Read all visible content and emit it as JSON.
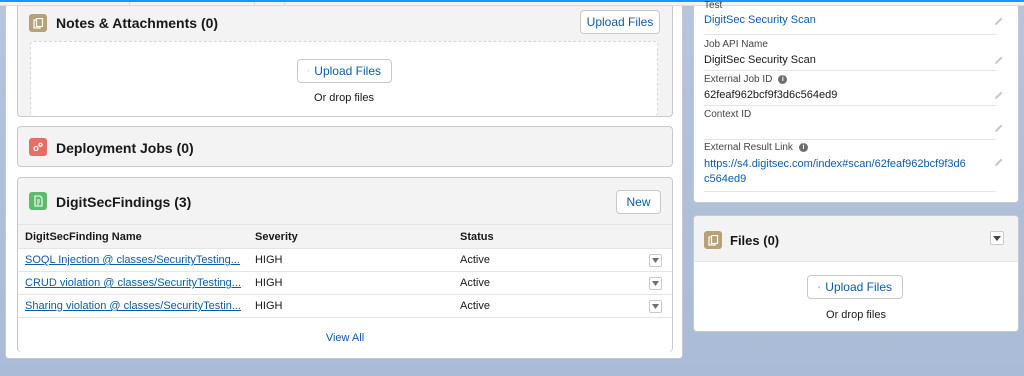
{
  "notes": {
    "title": "Notes & Attachments (0)",
    "upload_button": "Upload Files",
    "drop_upload_button": "Upload Files",
    "drop_text": "Or drop files"
  },
  "deployment": {
    "title": "Deployment Jobs (0)"
  },
  "findings": {
    "title": "DigitSecFindings (3)",
    "new_button": "New",
    "columns": [
      "DigitSecFinding Name",
      "Severity",
      "Status"
    ],
    "rows": [
      {
        "name": "SOQL Injection @ classes/SecurityTesting...",
        "severity": "HIGH",
        "status": "Active"
      },
      {
        "name": "CRUD violation @ classes/SecurityTesting...",
        "severity": "HIGH",
        "status": "Active"
      },
      {
        "name": "Sharing violation @ classes/SecurityTestin...",
        "severity": "HIGH",
        "status": "Active"
      }
    ],
    "view_all": "View All"
  },
  "details": {
    "test_label": "Test",
    "test_value": "DigitSec Security Scan",
    "job_api_label": "Job API Name",
    "job_api_value": "DigitSec Security Scan",
    "external_job_label": "External Job ID",
    "external_job_value": "62feaf962bcf9f3d6c564ed9",
    "context_label": "Context ID",
    "context_value": "",
    "result_link_label": "External Result Link",
    "result_link_line1": "https://s4.digitsec.com/index#scan/62feaf962bcf9f3d6",
    "result_link_line2": "c564ed9"
  },
  "files": {
    "title": "Files (0)",
    "upload_button": "Upload Files",
    "drop_text": "Or drop files"
  },
  "colors": {
    "brand_blue": "#0b5cab",
    "notes_icon": "#b8a079",
    "deploy_icon": "#e66e64",
    "findings_icon": "#5fbb6b",
    "files_icon": "#b8a079"
  },
  "icons": {
    "notes": "file-icon",
    "deploy": "deployment-icon",
    "findings": "report-icon",
    "files": "file-icon",
    "upload": "upload-icon",
    "edit": "pencil-icon",
    "info": "info-icon",
    "menu": "chevron-down-icon"
  }
}
